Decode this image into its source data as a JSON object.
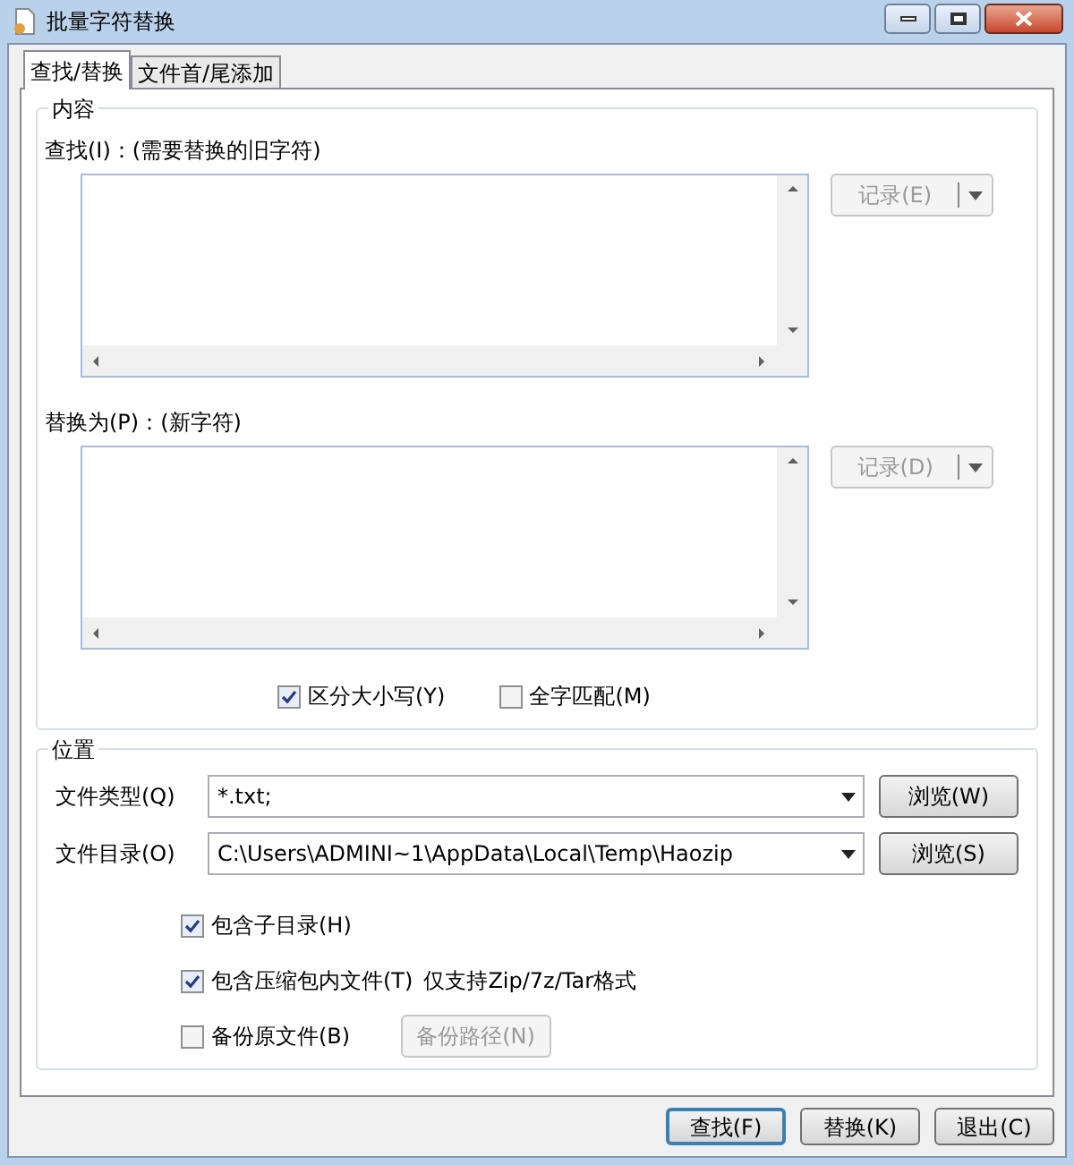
{
  "window": {
    "title": "批量字符替换"
  },
  "tabs": [
    {
      "label": "查找/替换",
      "selected": true
    },
    {
      "label": "文件首/尾添加",
      "selected": false
    }
  ],
  "content_group": {
    "title": "内容",
    "fields": [
      {
        "label": "查找(I)：(需要替换的旧字符)",
        "record_button": {
          "label": "记录(E)",
          "disabled": true
        }
      },
      {
        "label": "替换为(P)：(新字符)",
        "record_button": {
          "label": "记录(D)",
          "disabled": true
        }
      }
    ],
    "options": [
      {
        "label": "区分大小写(Y)",
        "checked": true
      },
      {
        "label": "全字匹配(M)",
        "checked": false
      }
    ]
  },
  "location_group": {
    "title": "位置",
    "fields": [
      {
        "label": "文件类型(Q)",
        "value": "*.txt;",
        "button": "浏览(W)"
      },
      {
        "label": "文件目录(O)",
        "value": "C:\\Users\\ADMINI~1\\AppData\\Local\\Temp\\Haozip",
        "button": "浏览(S)"
      }
    ],
    "options": [
      {
        "label": "包含子目录(H)",
        "checked": true
      },
      {
        "label": "包含压缩包内文件(T)",
        "note": "仅支持Zip/7z/Tar格式",
        "checked": true
      },
      {
        "label": "备份原文件(B)",
        "checked": false,
        "button": {
          "label": "备份路径(N)",
          "disabled": true
        }
      }
    ]
  },
  "buttons": [
    {
      "label": "查找(F)",
      "default": true
    },
    {
      "label": "替换(K)",
      "default": false
    },
    {
      "label": "退出(C)",
      "default": false
    }
  ]
}
